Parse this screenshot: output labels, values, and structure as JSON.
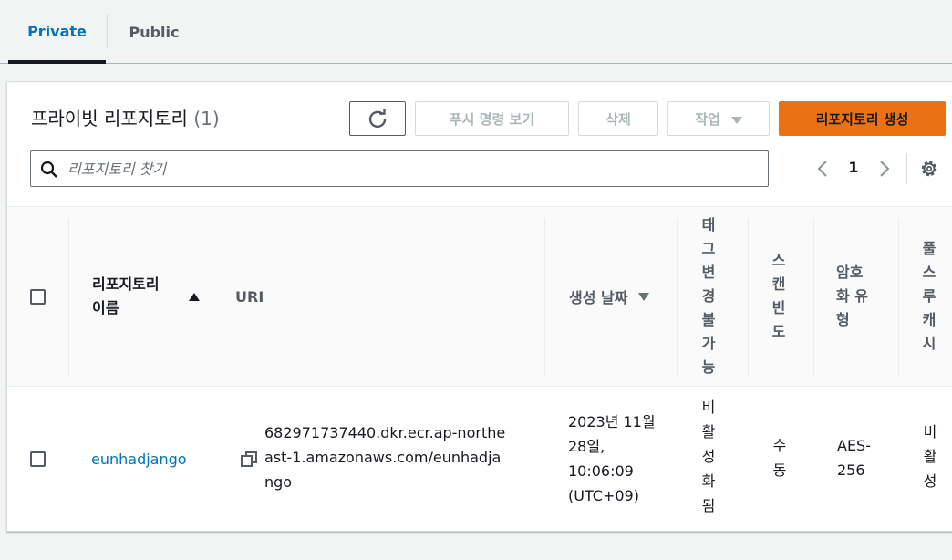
{
  "tabs": [
    {
      "label": "Private"
    },
    {
      "label": "Public"
    }
  ],
  "panel": {
    "title": "프라이빗 리포지토리",
    "count": "(1)"
  },
  "toolbar": {
    "push_label": "푸시 명령 보기",
    "delete_label": "삭제",
    "action_label": "작업",
    "create_label": "리포지토리 생성"
  },
  "search": {
    "placeholder": "리포지토리 찾기",
    "value": ""
  },
  "pagination": {
    "current_page": "1"
  },
  "table": {
    "columns": {
      "name": "리포지토리 이름",
      "uri": "URI",
      "created": "생성 날짜",
      "tag_immutability": "태그변경불가능",
      "scan_frequency": "스캔빈도",
      "encryption": "암호화 유형",
      "pull_cache": "풀스루캐시"
    },
    "rows": [
      {
        "name": "eunhadjango",
        "uri": "682971737440.dkr.ecr.ap-northeast-1.amazonaws.com/eunhadjango",
        "created": "2023년 11월 28일, 10:06:09 (UTC+09)",
        "tag_immutability": "비활성화됨",
        "scan_frequency": "수동",
        "encryption": "AES-256",
        "pull_cache": "비활성"
      }
    ]
  },
  "colors": {
    "accent": "#0073bb",
    "primary_button": "#ec7211",
    "background": "#f2f3f3"
  }
}
